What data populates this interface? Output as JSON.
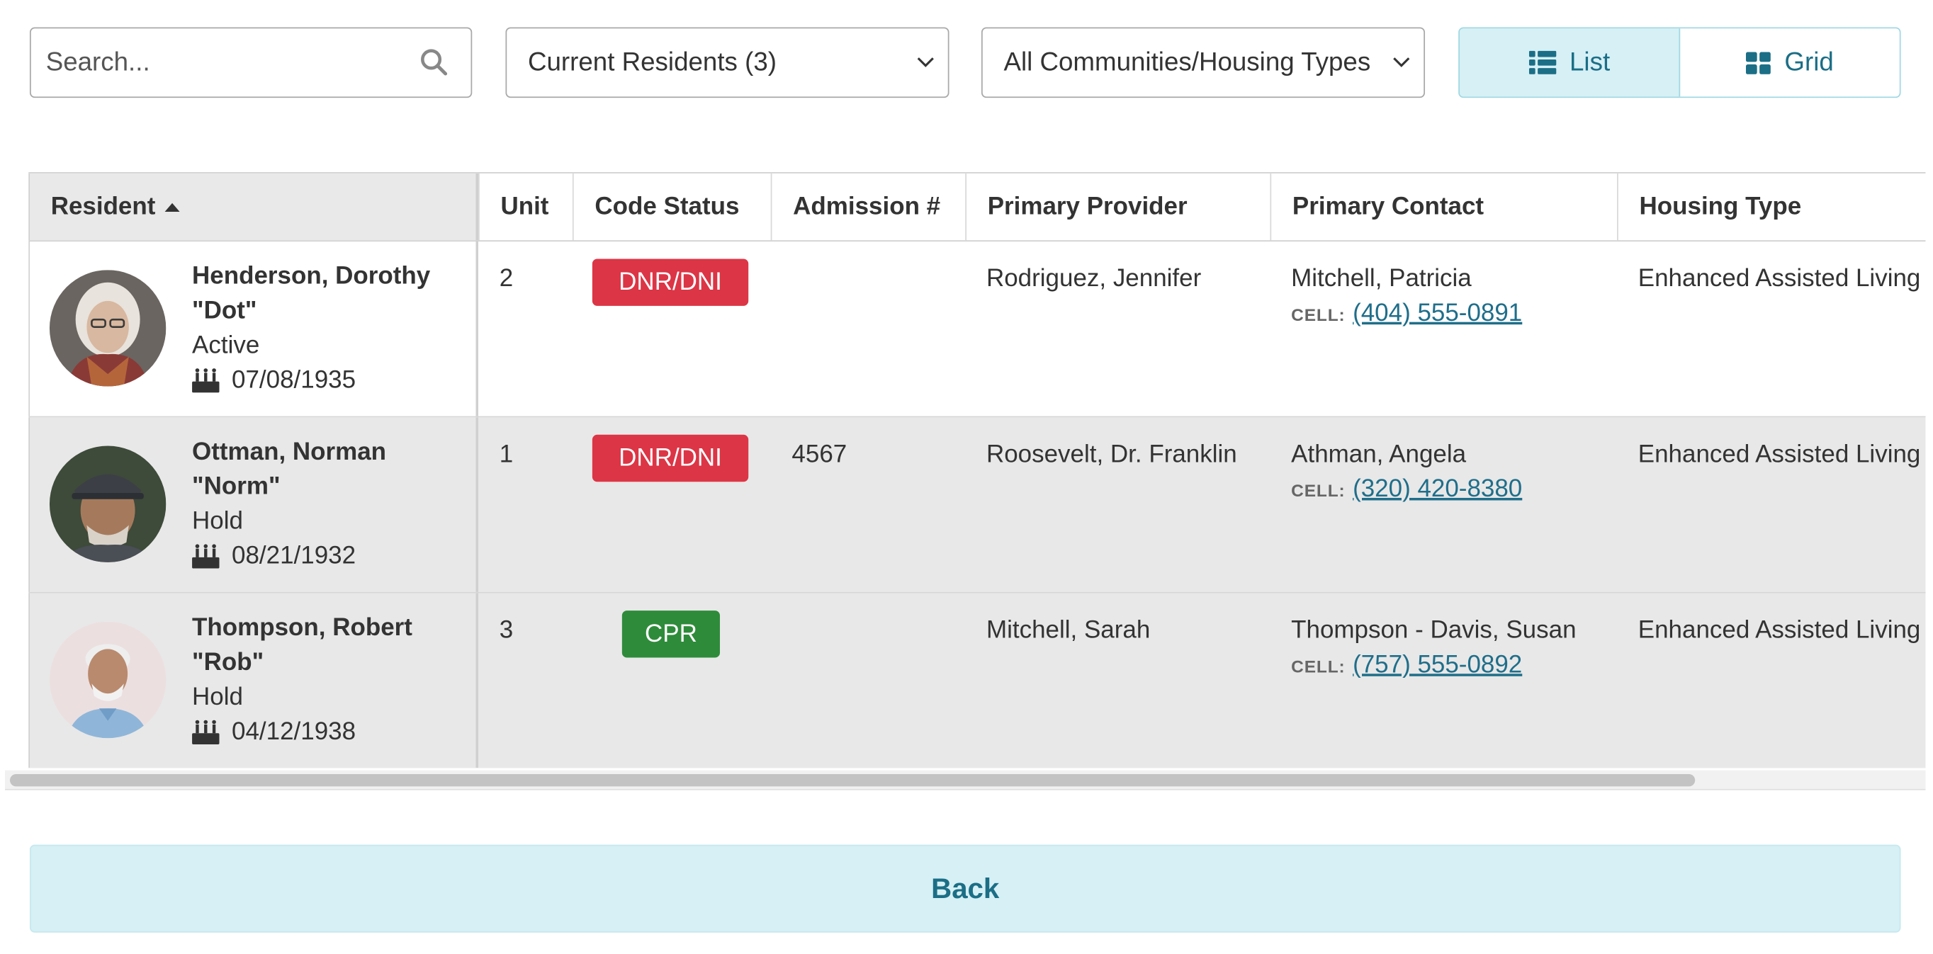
{
  "toolbar": {
    "search_placeholder": "Search...",
    "resident_filter": "Current Residents (3)",
    "community_filter": "All Communities/Housing Types",
    "view_list_label": "List",
    "view_grid_label": "Grid",
    "active_view": "List"
  },
  "table": {
    "headers": {
      "resident": "Resident",
      "unit": "Unit",
      "code_status": "Code Status",
      "admission": "Admission #",
      "provider": "Primary Provider",
      "contact": "Primary Contact",
      "housing": "Housing Type"
    },
    "sort": {
      "column": "Resident",
      "direction": "ascending"
    },
    "rows": [
      {
        "name": "Henderson, Dorothy \"Dot\"",
        "status": "Active",
        "dob": "07/08/1935",
        "unit": "2",
        "code_status": "DNR/DNI",
        "code_color": "#dc3545",
        "admission": "",
        "provider": "Rodriguez, Jennifer",
        "contact_name": "Mitchell, Patricia",
        "contact_label": "CELL:",
        "contact_phone": "(404) 555-0891",
        "housing": "Enhanced Assisted Living"
      },
      {
        "name": "Ottman, Norman \"Norm\"",
        "status": "Hold",
        "dob": "08/21/1932",
        "unit": "1",
        "code_status": "DNR/DNI",
        "code_color": "#dc3545",
        "admission": "4567",
        "provider": "Roosevelt, Dr. Franklin",
        "contact_name": "Athman, Angela",
        "contact_label": "CELL:",
        "contact_phone": "(320) 420-8380",
        "housing": "Enhanced Assisted Living"
      },
      {
        "name": "Thompson, Robert \"Rob\"",
        "status": "Hold",
        "dob": "04/12/1938",
        "unit": "3",
        "code_status": "CPR",
        "code_color": "#2e8b3a",
        "admission": "",
        "provider": "Mitchell, Sarah",
        "contact_name": "Thompson - Davis, Susan",
        "contact_label": "CELL:",
        "contact_phone": "(757) 555-0892",
        "housing": "Enhanced Assisted Living"
      }
    ]
  },
  "footer": {
    "back_label": "Back"
  },
  "icons": {
    "search": "search-icon",
    "dropdown": "chevron-down-icon",
    "list": "list-icon",
    "grid": "grid-icon",
    "birthday": "birthday-cake-icon"
  },
  "colors": {
    "accent": "#1b6e86",
    "accent_bg": "#d6f0f5",
    "dnr": "#dc3545",
    "cpr": "#2e8b3a"
  }
}
